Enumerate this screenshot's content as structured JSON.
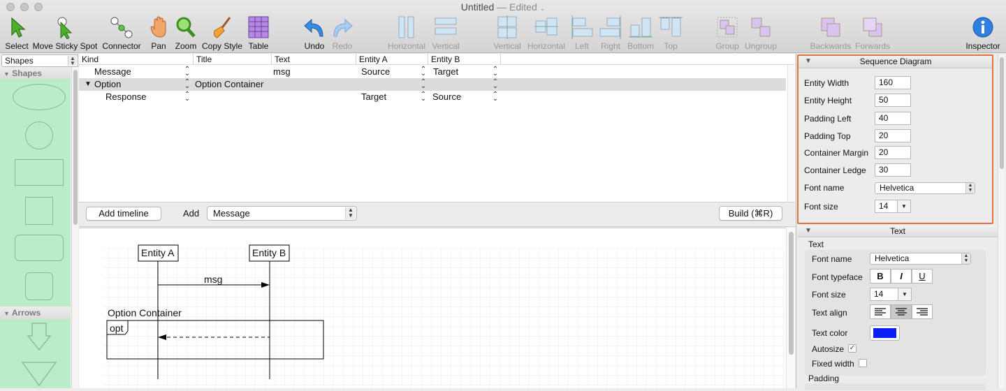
{
  "window": {
    "title": "Untitled",
    "edited": "— Edited"
  },
  "toolbar": {
    "select": "Select",
    "move_sticky_spot": "Move Sticky Spot",
    "connector": "Connector",
    "pan": "Pan",
    "zoom": "Zoom",
    "copy_style": "Copy Style",
    "table": "Table",
    "undo": "Undo",
    "redo": "Redo",
    "align_horizontal": "Horizontal",
    "align_vertical": "Vertical",
    "distribute_vertical": "Vertical",
    "distribute_horizontal": "Horizontal",
    "left": "Left",
    "right": "Right",
    "bottom": "Bottom",
    "top": "Top",
    "group": "Group",
    "ungroup": "Ungroup",
    "backwards": "Backwards",
    "forwards": "Forwards",
    "inspector": "Inspector"
  },
  "left_panel": {
    "selector_value": "Shapes",
    "shapes_header": "Shapes",
    "arrows_header": "Arrows"
  },
  "table": {
    "columns": [
      "Kind",
      "Title",
      "Text",
      "Entity A",
      "Entity B"
    ],
    "rows": [
      {
        "kind": "Message",
        "title": "",
        "text": "msg",
        "entity_a": "Source",
        "entity_b": "Target"
      },
      {
        "kind": "Option",
        "title": "Option Container",
        "text": "",
        "entity_a": "",
        "entity_b": ""
      },
      {
        "kind": "Response",
        "title": "",
        "text": "",
        "entity_a": "Target",
        "entity_b": "Source"
      }
    ]
  },
  "midbar": {
    "add_timeline": "Add timeline",
    "add_label": "Add",
    "add_kind": "Message",
    "build": "Build (⌘R)"
  },
  "diagram": {
    "entity_a": "Entity A",
    "entity_b": "Entity B",
    "message": "msg",
    "container_title": "Option Container",
    "container_tag": "opt"
  },
  "inspector": {
    "sequence_header": "Sequence Diagram",
    "entity_width_label": "Entity Width",
    "entity_width": "160",
    "entity_height_label": "Entity Height",
    "entity_height": "50",
    "padding_left_label": "Padding Left",
    "padding_left": "40",
    "padding_top_label": "Padding Top",
    "padding_top": "20",
    "container_margin_label": "Container Margin",
    "container_margin": "20",
    "container_ledge_label": "Container Ledge",
    "container_ledge": "30",
    "font_name_label": "Font name",
    "font_name": "Helvetica",
    "font_size_label": "Font size",
    "font_size": "14",
    "text_header": "Text",
    "text_group": "Text",
    "text_font_name_label": "Font name",
    "text_font_name": "Helvetica",
    "font_typeface_label": "Font typeface",
    "bold": "B",
    "italic": "I",
    "underline": "U",
    "text_font_size_label": "Font size",
    "text_font_size": "14",
    "text_align_label": "Text align",
    "text_color_label": "Text color",
    "text_color": "#0a1ff5",
    "autosize_label": "Autosize",
    "fixed_width_label": "Fixed width",
    "padding_label": "Padding"
  },
  "colors": {
    "accent_highlight": "#e2733a",
    "shape_library_bg": "#b9ecc8"
  }
}
